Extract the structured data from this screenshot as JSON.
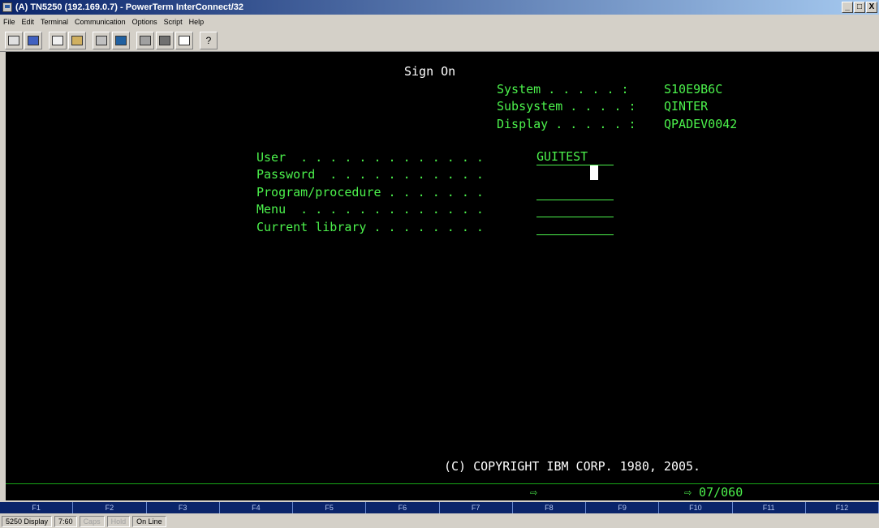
{
  "window": {
    "title": "(A) TN5250 (192.169.0.7) - PowerTerm InterConnect/32",
    "min": "_",
    "max": "□",
    "close": "X"
  },
  "menu": [
    "File",
    "Edit",
    "Terminal",
    "Communication",
    "Options",
    "Script",
    "Help"
  ],
  "toolbar": {
    "help_label": "?"
  },
  "screen": {
    "title": "Sign On",
    "system_label": "System . . . . . :",
    "system_value": "S10E9B6C",
    "subsystem_label": "Subsystem . . . . :",
    "subsystem_value": "QINTER",
    "display_label": "Display . . . . . :",
    "display_value": "QPADEV0042",
    "user_label": "User  . . . . . . . . . . . . .",
    "user_value": "GUITEST",
    "password_label": "Password  . . . . . . . . . . .",
    "program_label": "Program/procedure . . . . . . .",
    "menu_label": "Menu  . . . . . . . . . . . . .",
    "library_label": "Current library . . . . . . . .",
    "copyright": "(C) COPYRIGHT IBM CORP. 1980, 2005.",
    "arrow": "⇨",
    "position": "⇨ 07/060"
  },
  "fkeys": [
    "F1",
    "F2",
    "F3",
    "F4",
    "F5",
    "F6",
    "F7",
    "F8",
    "F9",
    "F10",
    "F11",
    "F12"
  ],
  "status": {
    "display": "5250 Display",
    "pos": "7:60",
    "caps": "Caps",
    "hold": "Hold",
    "online": "On Line"
  }
}
